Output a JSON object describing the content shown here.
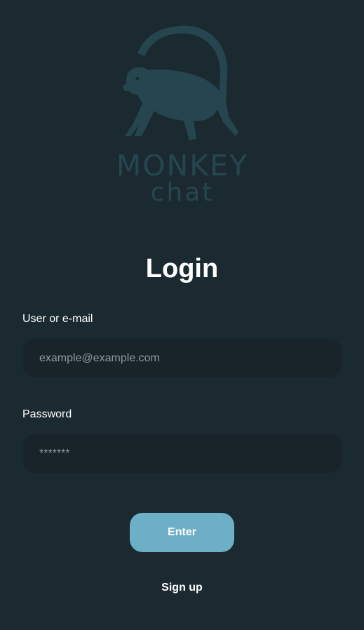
{
  "logo": {
    "icon": "monkey-icon",
    "title": "MONKEY",
    "subtitle": "chat",
    "color": "#26464f"
  },
  "page": {
    "title": "Login",
    "background": "#1b2a31"
  },
  "form": {
    "user": {
      "label": "User or e-mail",
      "placeholder": "example@example.com",
      "value": ""
    },
    "password": {
      "label": "Password",
      "placeholder": "*******",
      "value": ""
    },
    "submit_label": "Enter",
    "submit_color": "#6cafc6",
    "signup_label": "Sign up"
  }
}
